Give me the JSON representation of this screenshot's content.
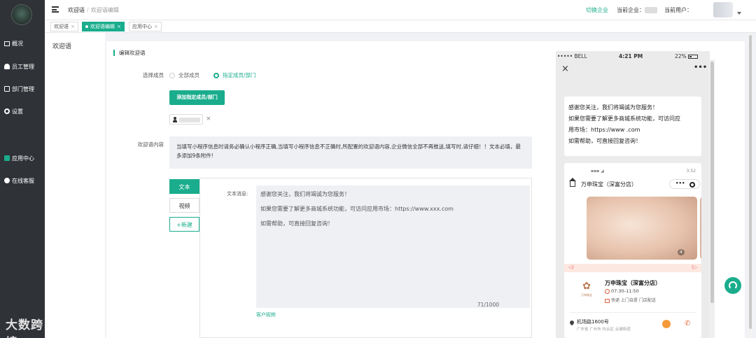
{
  "sidebar": {
    "items": [
      {
        "label": "概况",
        "icon": "monitor-icon"
      },
      {
        "label": "员工管理",
        "icon": "user-icon"
      },
      {
        "label": "部门管理",
        "icon": "org-icon"
      },
      {
        "label": "设置",
        "icon": "gear-icon"
      },
      {
        "label": "应用中心",
        "icon": "grid-icon"
      },
      {
        "label": "在线客服",
        "icon": "headset-icon"
      }
    ],
    "watermark": "大数跨境"
  },
  "header": {
    "breadcrumb": [
      "欢迎语",
      "欢迎语编辑"
    ],
    "switch_enterprise": "切换企业",
    "current_enterprise_label": "当前企业：",
    "current_user_label": "当前用户："
  },
  "tabs": [
    {
      "label": "欢迎语",
      "close": "×"
    },
    {
      "label": "欢迎语编辑",
      "close": "×"
    },
    {
      "label": "应用中心",
      "close": "×"
    }
  ],
  "subnav": {
    "title": "欢迎语"
  },
  "form": {
    "section_title": "编辑欢迎语",
    "select_members_label": "选择成员",
    "radio_all": "全部成员",
    "radio_specified": "指定成员/部门",
    "add_button": "添加指定成员/部门",
    "chip_remove": "×",
    "content_label": "欢迎语内容",
    "notice": "当填写小程序信息时请务必确认小程序正确,当填写小程序信息不正确时,所配置的欢迎语内容,企业微信全部不再推送,填写时,请仔细！！文本必填，最多添加9条附件!"
  },
  "editor": {
    "tabs": [
      "文本",
      "视频",
      "+新建"
    ],
    "message_label": "文本消息:",
    "lines": [
      "感谢您关注，我们将竭诚为您服务！",
      "如果您需要了解更多商城系统功能，可访问应用市场：https://www.xxx.com",
      "如需帮助，可直接回复咨询！"
    ],
    "counter": "71/1000",
    "nickname_link": "客户昵称"
  },
  "phone": {
    "status_left": "••••• BELL",
    "time": "4:21 PM",
    "status_right": "22%",
    "close": "×",
    "more": "•••",
    "bubble_lines": [
      "感谢您关注，我们将竭诚为您服务！",
      "如果您需要了解更多商城系统功能，可访问应",
      "用市场：https://www .com",
      "如需帮助，可直接回复咨询！"
    ],
    "mini": {
      "status_right": "3:52",
      "title": "万申珠宝（深富分店）",
      "capsule_dots": "•••",
      "image_count": "4",
      "store_name": "万申珠宝（深富分店）",
      "hours": "07:30-11:50",
      "services": "快递 上门自提 门店配送",
      "logo_text": "万申珠宝",
      "address": "机场路1600号",
      "address_sub": "广东省 广州市 白云区 云城街道"
    }
  },
  "colors": {
    "accent": "#1aad8d",
    "sidebar": "#2f3237"
  }
}
